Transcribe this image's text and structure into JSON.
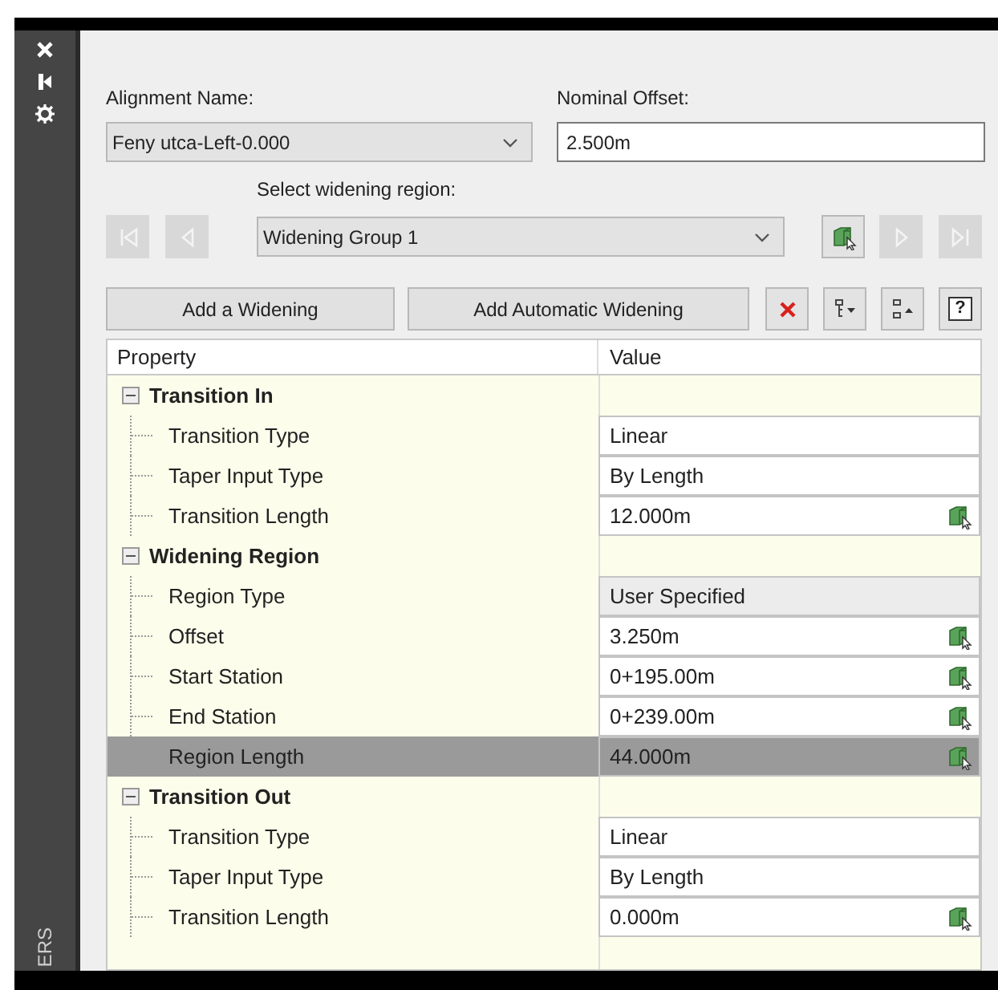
{
  "sidebar": {
    "label": "ERS"
  },
  "alignment": {
    "label": "Alignment Name:",
    "value": "Feny utca-Left-0.000"
  },
  "offset": {
    "label": "Nominal Offset:",
    "value": "2.500m"
  },
  "region_select": {
    "label": "Select widening region:",
    "value": "Widening Group 1"
  },
  "buttons": [
    "Add a Widening",
    "Add Automatic Widening"
  ],
  "help": {
    "label": "?"
  },
  "grid": {
    "columns": [
      "Property",
      "Value"
    ],
    "groups": [
      {
        "label": "Transition In",
        "expanded": true,
        "children": [
          {
            "label": "Transition Type",
            "value": "Linear",
            "editable": true,
            "picker": false,
            "selected": false
          },
          {
            "label": "Taper Input Type",
            "value": "By Length",
            "editable": true,
            "picker": false,
            "selected": false
          },
          {
            "label": "Transition Length",
            "value": "12.000m",
            "editable": true,
            "picker": true,
            "selected": false
          }
        ]
      },
      {
        "label": "Widening Region",
        "expanded": true,
        "children": [
          {
            "label": "Region Type",
            "value": "User Specified",
            "editable": false,
            "picker": false,
            "selected": false
          },
          {
            "label": "Offset",
            "value": "3.250m",
            "editable": true,
            "picker": true,
            "selected": false
          },
          {
            "label": "Start Station",
            "value": "0+195.00m",
            "editable": true,
            "picker": true,
            "selected": false
          },
          {
            "label": "End Station",
            "value": "0+239.00m",
            "editable": true,
            "picker": true,
            "selected": false
          },
          {
            "label": "Region Length",
            "value": "44.000m",
            "editable": true,
            "picker": true,
            "selected": true
          }
        ]
      },
      {
        "label": "Transition Out",
        "expanded": true,
        "children": [
          {
            "label": "Transition Type",
            "value": "Linear",
            "editable": true,
            "picker": false,
            "selected": false
          },
          {
            "label": "Taper Input Type",
            "value": "By Length",
            "editable": true,
            "picker": false,
            "selected": false
          },
          {
            "label": "Transition Length",
            "value": "0.000m",
            "editable": true,
            "picker": true,
            "selected": false
          }
        ]
      }
    ]
  }
}
